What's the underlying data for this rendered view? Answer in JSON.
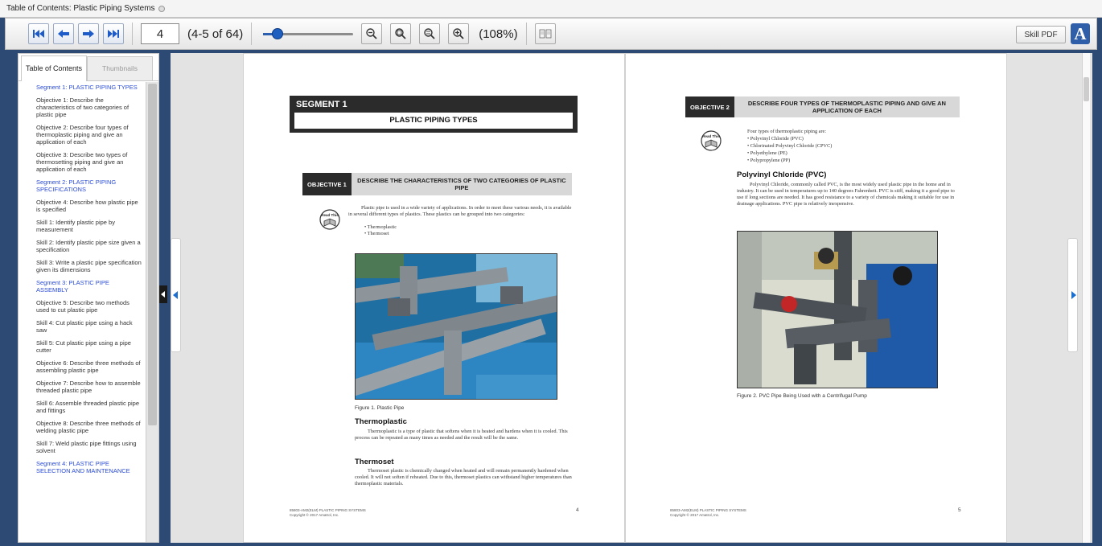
{
  "window": {
    "title": "Table of Contents: Plastic Piping Systems"
  },
  "toolbar": {
    "page_input": "4",
    "page_count": "(4-5 of 64)",
    "zoom_level": "(108%)",
    "zoom_slider_fraction": 0.16,
    "skill_pdf_label": "Skill PDF",
    "accessibility_label": "A",
    "nav_icons": [
      "first-page-icon",
      "previous-page-icon",
      "next-page-icon",
      "last-page-icon"
    ],
    "zoom_icons": [
      "zoom-out-icon",
      "zoom-fit-width-icon",
      "zoom-fit-page-icon",
      "zoom-in-icon"
    ],
    "view_icon": "two-page-view-icon",
    "accent_color": "#1f5fc0"
  },
  "sidebar": {
    "tabs": [
      {
        "label": "Table of Contents",
        "active": true
      },
      {
        "label": "Thumbnails",
        "active": false
      }
    ],
    "toc": [
      {
        "label": "Segment 1: PLASTIC PIPING TYPES",
        "segment": true
      },
      {
        "label": "Objective 1: Describe the characteristics of two categories of plastic pipe",
        "segment": false
      },
      {
        "label": "Objective 2: Describe four types of thermoplastic piping and give an application of each",
        "segment": false
      },
      {
        "label": "Objective 3: Describe two types of thermosetting piping and give an application of each",
        "segment": false
      },
      {
        "label": "Segment 2: PLASTIC PIPING SPECIFICATIONS",
        "segment": true
      },
      {
        "label": "Objective 4: Describe how plastic pipe is specified",
        "segment": false
      },
      {
        "label": "Skill 1: Identify plastic pipe by measurement",
        "segment": false
      },
      {
        "label": "Skill 2: Identify plastic pipe size given a specification",
        "segment": false
      },
      {
        "label": "Skill 3: Write a plastic pipe specification given its dimensions",
        "segment": false
      },
      {
        "label": "Segment 3: PLASTIC PIPE ASSEMBLY",
        "segment": true
      },
      {
        "label": "Objective 5: Describe two methods used to cut plastic pipe",
        "segment": false
      },
      {
        "label": "Skill 4: Cut plastic pipe using a hack saw",
        "segment": false
      },
      {
        "label": "Skill 5: Cut plastic pipe using a pipe cutter",
        "segment": false
      },
      {
        "label": "Objective 6: Describe three methods of assembling plastic pipe",
        "segment": false
      },
      {
        "label": "Objective 7: Describe how to assemble threaded plastic pipe",
        "segment": false
      },
      {
        "label": "Skill 6: Assemble threaded plastic pipe and fittings",
        "segment": false
      },
      {
        "label": "Objective 8: Describe three methods of welding plastic pipe",
        "segment": false
      },
      {
        "label": "Skill 7: Weld plastic pipe fittings using solvent",
        "segment": false
      },
      {
        "label": "Segment 4: PLASTIC PIPE SELECTION AND MAINTENANCE",
        "segment": true
      }
    ]
  },
  "left_page": {
    "segment_number": "SEGMENT 1",
    "segment_title": "PLASTIC PIPING TYPES",
    "objective_tag": "OBJECTIVE 1",
    "objective_text": "DESCRIBE THE CHARACTERISTICS OF TWO CATEGORIES OF PLASTIC PIPE",
    "read_icon": "read-this-book-icon",
    "intro": "Plastic pipe is used in a wide variety of applications. In order to meet these various needs, it is available in several different types of plastics. These plastics can be grouped into two categories:",
    "bullets": [
      "• Thermoplastic",
      "• Thermoset"
    ],
    "figure_caption": "Figure 1.   Plastic Pipe",
    "heading_1": "Thermoplastic",
    "para_1": "Thermoplastic is a type of plastic that softens when it is heated and hardens when it is cooled. This process can be repeated as many times as needed and the result will be the same.",
    "heading_2": "Thermoset",
    "para_2": "Thermoset plastic is chemically changed when heated and will remain permanently hardened when cooled. It will not soften if reheated. Due to this, thermoset plastics can withstand higher temperatures than thermoplastic materials.",
    "footer_line1": "85803-AM2(ELM)   PLASTIC PIPING SYSTEMS",
    "footer_line2": "Copyright © 2017 Amatrol, Inc.",
    "page_number": "4"
  },
  "right_page": {
    "objective_tag": "OBJECTIVE 2",
    "objective_text": "DESCRIBE FOUR TYPES OF THERMOPLASTIC PIPING AND GIVE AN APPLICATION OF EACH",
    "read_icon": "read-this-book-icon",
    "intro": "Four types of thermoplastic piping are:",
    "bullets": [
      "• Polyvinyl Chloride (PVC)",
      "• Chlorinated Polyvinyl Chloride (CPVC)",
      "• Polyethylene (PE)",
      "• Polypropylene (PP)"
    ],
    "heading_1": "Polyvinyl Chloride (PVC)",
    "para_1": "Polyvinyl Chloride, commonly called PVC, is the most widely used plastic pipe in the home and in industry. It can be used in temperatures up to 140 degrees Fahrenheit. PVC is stiff, making it a good pipe to use if long sections are needed. It has good resistance to a variety of chemicals making it suitable for use in drainage applications. PVC pipe is relatively inexpensive.",
    "figure_caption": "Figure 2.   PVC Pipe Being Used with a Centrifugal Pump",
    "footer_line1": "85803-AM2(ELM)   PLASTIC PIPING SYSTEMS",
    "footer_line2": "Copyright © 2017 Amatrol, Inc.",
    "page_number": "5"
  }
}
